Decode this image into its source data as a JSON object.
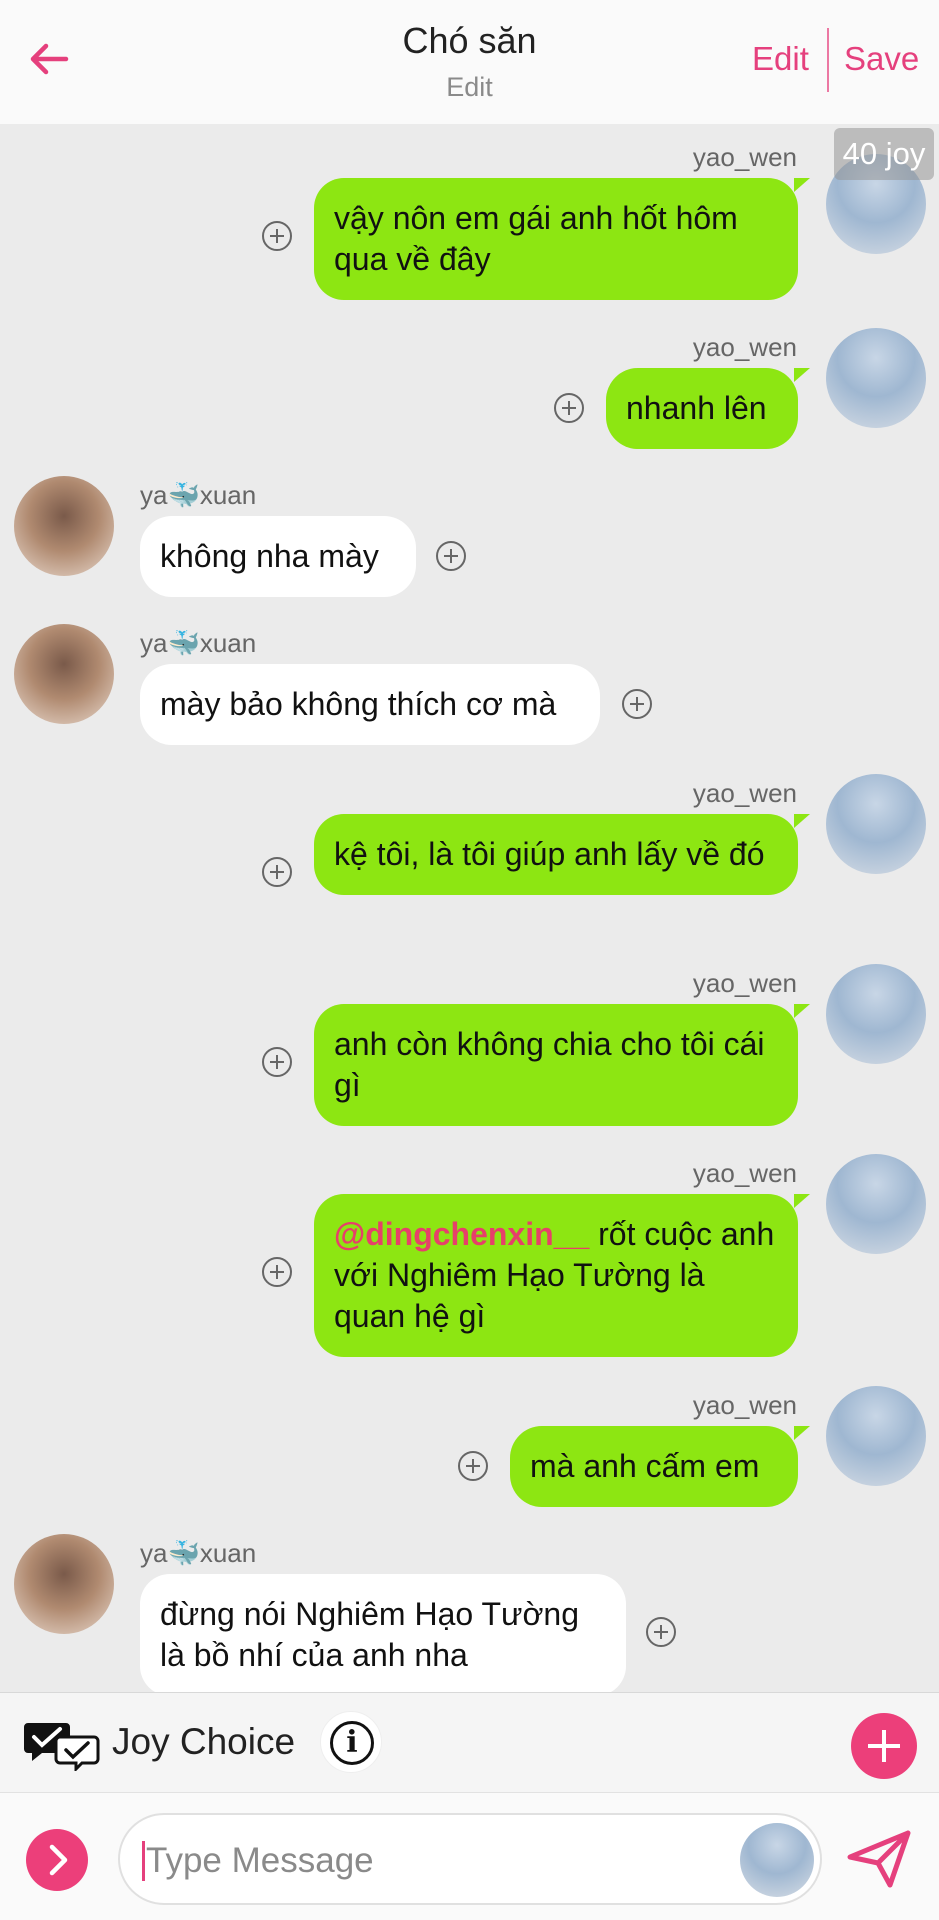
{
  "header": {
    "title": "Chó săn",
    "subtitle": "Edit",
    "edit_label": "Edit",
    "save_label": "Save"
  },
  "badge": "40 joy",
  "messages": [
    {
      "side": "right",
      "user": "yao_wen",
      "text": "vậy nôn em gái anh hốt hôm qua về đây"
    },
    {
      "side": "right",
      "user": "yao_wen",
      "text": "nhanh lên"
    },
    {
      "side": "left",
      "user": "ya🐳xuan",
      "text": "không nha mày"
    },
    {
      "side": "left",
      "user": "ya🐳xuan",
      "text": "mày bảo không thích cơ mà"
    },
    {
      "side": "right",
      "user": "yao_wen",
      "text": "kệ tôi, là tôi giúp anh lấy về đó"
    },
    {
      "side": "right",
      "user": "yao_wen",
      "text": "anh còn không chia cho tôi cái gì"
    },
    {
      "side": "right",
      "user": "yao_wen",
      "mention": "@dingchenxin__",
      "text": " rốt cuộc anh với Nghiêm Hạo Tường là quan hệ gì"
    },
    {
      "side": "right",
      "user": "yao_wen",
      "text": "mà anh cấm em"
    },
    {
      "side": "left",
      "user": "ya🐳xuan",
      "text": "đừng nói Nghiêm Hạo Tường là bồ nhí của anh nha"
    }
  ],
  "choice_bar": {
    "label": "Joy Choice",
    "info_icon": "i"
  },
  "input_bar": {
    "placeholder": "Type Message"
  },
  "colors": {
    "accent": "#e5407d",
    "bubble_green": "#8de612",
    "bubble_white": "#ffffff",
    "chat_bg": "#ebebeb"
  }
}
